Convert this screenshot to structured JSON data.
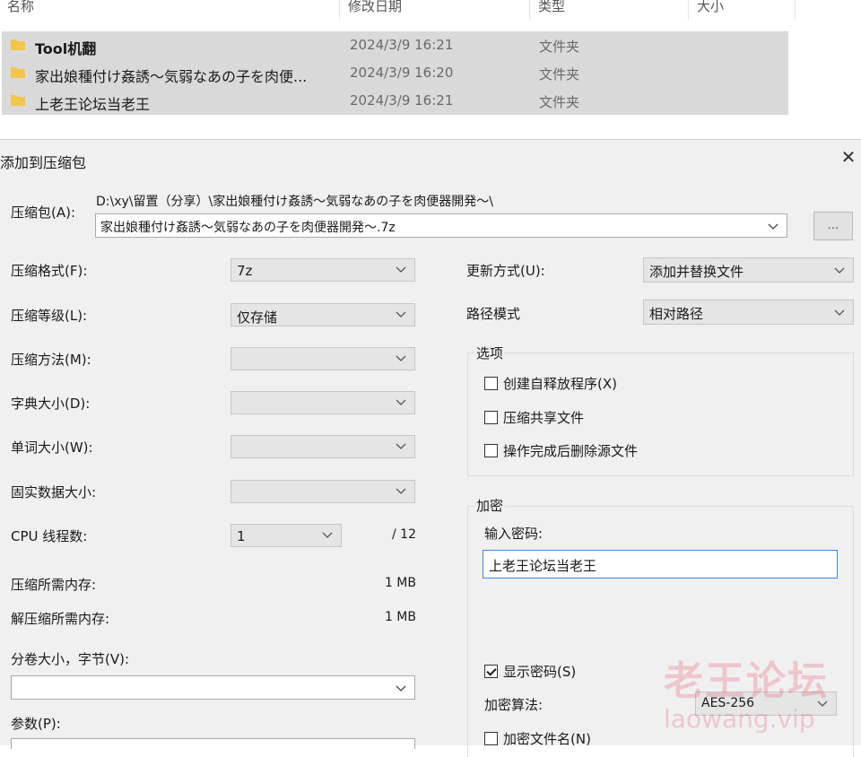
{
  "explorer": {
    "columns": [
      "名称",
      "修改日期",
      "类型",
      "大小"
    ],
    "rows": [
      {
        "name": "Tool机翻",
        "date": "2024/3/9 16:21",
        "type": "文件夹"
      },
      {
        "name": "家出娘種付け姦誘～気弱なあの子を肉便...",
        "date": "2024/3/9 16:20",
        "type": "文件夹"
      },
      {
        "name": "上老王论坛当老王",
        "date": "2024/3/9 16:21",
        "type": "文件夹"
      }
    ]
  },
  "dialog": {
    "title": "添加到压缩包",
    "close_glyph": "✕",
    "archive": {
      "label": "压缩包(A):",
      "path": "D:\\xy\\留置（分享）\\家出娘種付け姦誘～気弱なあの子を肉便器開発～\\",
      "name": "家出娘種付け姦誘～気弱なあの子を肉便器開発～.7z",
      "browse_label": "..."
    },
    "left": {
      "format": {
        "label": "压缩格式(F):",
        "value": "7z"
      },
      "level": {
        "label": "压缩等级(L):",
        "value": "仅存储"
      },
      "method": {
        "label": "压缩方法(M):",
        "value": ""
      },
      "dict": {
        "label": "字典大小(D):",
        "value": ""
      },
      "word": {
        "label": "单词大小(W):",
        "value": ""
      },
      "solid": {
        "label": "固实数据大小:",
        "value": ""
      },
      "threads": {
        "label": "CPU 线程数:",
        "value": "1",
        "total": "/ 12"
      },
      "mem_compress": {
        "label": "压缩所需内存:",
        "value": "1 MB"
      },
      "mem_decompress": {
        "label": "解压缩所需内存:",
        "value": "1 MB"
      },
      "volume": {
        "label": "分卷大小，字节(V):",
        "value": ""
      },
      "params": {
        "label": "参数(P):"
      }
    },
    "right": {
      "update": {
        "label": "更新方式(U):",
        "value": "添加并替换文件"
      },
      "pathmode": {
        "label": "路径模式",
        "value": "相对路径"
      },
      "options": {
        "title": "选项",
        "items": [
          {
            "label": "创建自释放程序(X)",
            "checked": false
          },
          {
            "label": "压缩共享文件",
            "checked": false
          },
          {
            "label": "操作完成后删除源文件",
            "checked": false
          }
        ]
      },
      "encrypt": {
        "title": "加密",
        "pw_label": "输入密码:",
        "password": "上老王论坛当老王",
        "show_pw": {
          "label": "显示密码(S)",
          "checked": true
        },
        "algo_label": "加密算法:",
        "algo_value": "AES-256",
        "encrypt_names": {
          "label": "加密文件名(N)",
          "checked": false
        }
      }
    }
  },
  "watermark": {
    "cn": "老王论坛",
    "en": "laowang.vip"
  },
  "colors": {
    "folder": "#f2c54b",
    "selection": "#d9d9d9",
    "dialog_bg": "#f0f0f0",
    "focus_border": "#3c8be0"
  },
  "icons": {
    "folder": "folder-icon",
    "chevron": "chevron-down-icon",
    "close": "close-icon",
    "check": "checkbox-check-icon"
  }
}
